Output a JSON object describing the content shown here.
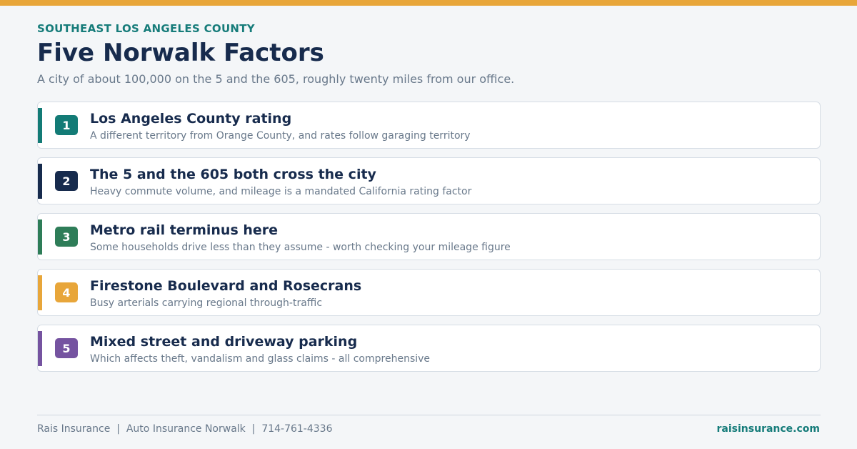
{
  "theme": {
    "top_bar_color": "#e8a63a",
    "teal": "#167c7a",
    "navy": "#172b4d"
  },
  "header": {
    "eyebrow": "SOUTHEAST LOS ANGELES COUNTY",
    "title": "Five Norwalk Factors",
    "subtitle": "A city of about 100,000 on the 5 and the 605, roughly twenty miles from our office."
  },
  "factors": [
    {
      "number": "1",
      "title": "Los Angeles County rating",
      "description": "A different territory from Orange County, and rates follow garaging territory",
      "color": "#137b76"
    },
    {
      "number": "2",
      "title": "The 5 and the 605 both cross the city",
      "description": "Heavy commute volume, and mileage is a mandated California rating factor",
      "color": "#172b4d"
    },
    {
      "number": "3",
      "title": "Metro rail terminus here",
      "description": "Some households drive less than they assume - worth checking your mileage figure",
      "color": "#2e7d58"
    },
    {
      "number": "4",
      "title": "Firestone Boulevard and Rosecrans",
      "description": "Busy arterials carrying regional through-traffic",
      "color": "#e8a63a"
    },
    {
      "number": "5",
      "title": "Mixed street and driveway parking",
      "description": "Which affects theft, vandalism and glass claims - all comprehensive",
      "color": "#7553a0"
    }
  ],
  "footer": {
    "brand": "Rais Insurance",
    "page": "Auto Insurance Norwalk",
    "phone": "714-761-4336",
    "separator": "  |  ",
    "website": "raisinsurance.com"
  }
}
